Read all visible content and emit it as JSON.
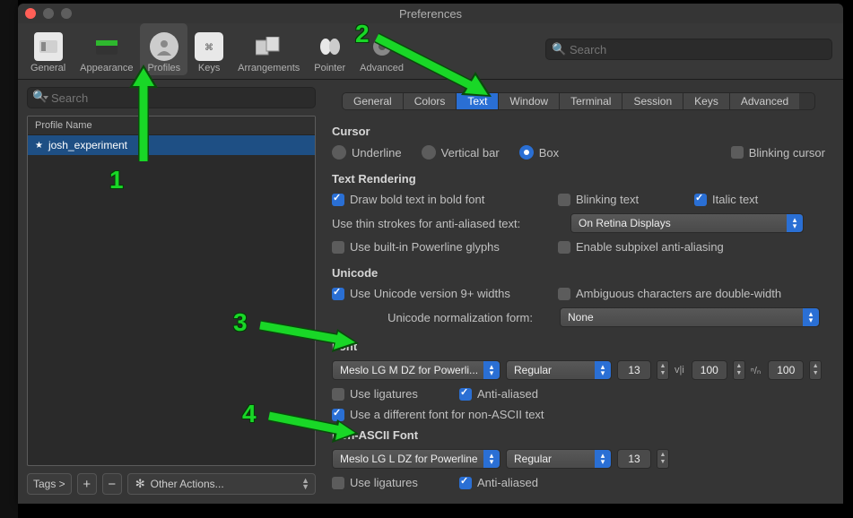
{
  "window": {
    "title": "Preferences"
  },
  "toolbar": {
    "items": [
      {
        "label": "General"
      },
      {
        "label": "Appearance"
      },
      {
        "label": "Profiles"
      },
      {
        "label": "Keys"
      },
      {
        "label": "Arrangements"
      },
      {
        "label": "Pointer"
      },
      {
        "label": "Advanced"
      }
    ],
    "search_placeholder": "Search"
  },
  "sidebar": {
    "search_placeholder": "Search",
    "header": "Profile Name",
    "profile": "josh_experiment",
    "tags_label": "Tags >",
    "other_actions": "Other Actions..."
  },
  "tabs": [
    "General",
    "Colors",
    "Text",
    "Window",
    "Terminal",
    "Session",
    "Keys",
    "Advanced"
  ],
  "cursor": {
    "heading": "Cursor",
    "underline": "Underline",
    "vertical": "Vertical bar",
    "box": "Box",
    "blinking": "Blinking cursor"
  },
  "textrender": {
    "heading": "Text Rendering",
    "bold": "Draw bold text in bold font",
    "blinking": "Blinking text",
    "italic": "Italic text",
    "thin_label": "Use thin strokes for anti-aliased text:",
    "thin_value": "On Retina Displays",
    "powerline": "Use built-in Powerline glyphs",
    "subpixel": "Enable subpixel anti-aliasing"
  },
  "unicode": {
    "heading": "Unicode",
    "v9": "Use Unicode version 9+ widths",
    "ambiguous": "Ambiguous characters are double-width",
    "norm_label": "Unicode normalization form:",
    "norm_value": "None"
  },
  "font": {
    "heading": "Font",
    "family": "Meslo LG M DZ for Powerli...",
    "style": "Regular",
    "size": "13",
    "vi": "100",
    "n": "100",
    "ligatures": "Use ligatures",
    "aa": "Anti-aliased",
    "diff": "Use a different font for non-ASCII text"
  },
  "nonascii": {
    "heading": "Non-ASCII Font",
    "family": "Meslo LG L DZ for Powerline",
    "style": "Regular",
    "size": "13",
    "ligatures": "Use ligatures",
    "aa": "Anti-aliased"
  },
  "annotations": {
    "n1": "1",
    "n2": "2",
    "n3": "3",
    "n4": "4"
  }
}
